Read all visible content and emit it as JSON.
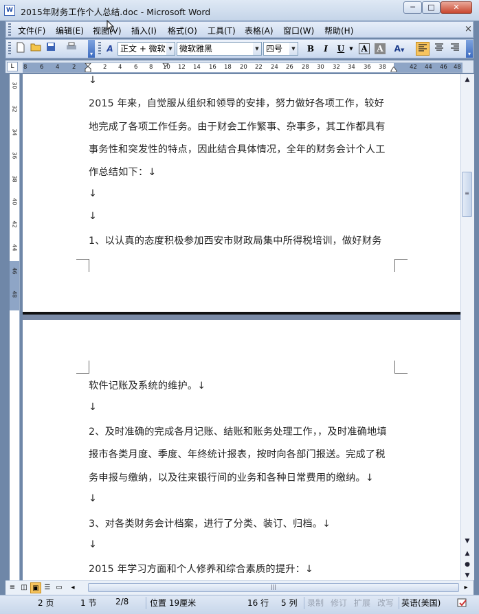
{
  "window": {
    "title": "2015年财务工作个人总结.doc - Microsoft Word",
    "icon": "word-doc-icon",
    "controls": {
      "minimize": "─",
      "maximize": "□",
      "close": "✕"
    }
  },
  "menu": {
    "items": [
      "文件(F)",
      "编辑(E)",
      "视图(V)",
      "插入(I)",
      "格式(O)",
      "工具(T)",
      "表格(A)",
      "窗口(W)",
      "帮助(H)"
    ],
    "close_glyph": "×"
  },
  "toolbar": {
    "style_value": "正文 + 微软",
    "font_value": "微软雅黑",
    "size_value": "四号",
    "bold": "B",
    "italic": "I",
    "underline": "U",
    "font_color": "A",
    "highlight": "A"
  },
  "ruler": {
    "corner": "L",
    "h_ticks": [
      "8",
      "6",
      "4",
      "2",
      "2",
      "4",
      "6",
      "8",
      "10",
      "12",
      "14",
      "16",
      "18",
      "20",
      "22",
      "24",
      "26",
      "28",
      "30",
      "32",
      "34",
      "36",
      "38",
      "42",
      "44",
      "46",
      "48"
    ],
    "v_ticks": [
      "30",
      "32",
      "34",
      "36",
      "38",
      "40",
      "42",
      "44",
      "46",
      "48"
    ]
  },
  "document": {
    "page1": [
      "↓",
      "2015 年来，自觉服从组织和领导的安排，努力做好各项工作，较好",
      "地完成了各项工作任务。由于财会工作繁事、杂事多，其工作都具有",
      "事务性和突发性的特点，因此结合具体情况，全年的财务会计个人工",
      "作总结如下：↓",
      "↓",
      "↓",
      "1、以认真的态度积极参加西安市财政局集中所得税培训，做好财务"
    ],
    "page2": [
      "软件记账及系统的维护。↓",
      "↓",
      "2、及时准确的完成各月记账、结账和账务处理工作，，及时准确地填",
      "报市各类月度、季度、年终统计报表，按时向各部门报送。完成了税",
      "务申报与缴纳，以及往来银行间的业务和各种日常费用的缴纳。↓",
      "↓",
      "3、对各类财务会计档案，进行了分类、装订、归档。↓",
      "↓",
      "2015 年学习方面和个人修养和综合素质的提升：↓"
    ]
  },
  "status": {
    "page": "2 页",
    "section": "1 节",
    "pages": "2/8",
    "position": "位置 19厘米",
    "line": "16 行",
    "column": "5 列",
    "rec": "录制",
    "trk": "修订",
    "ext": "扩展",
    "ovr": "改写",
    "language": "英语(美国)"
  },
  "colors": {
    "titlebar": "#c4d4e8",
    "close_button": "#c9462e",
    "ruler_margin": "#8ea5c6",
    "document_background": "#7484a2"
  }
}
